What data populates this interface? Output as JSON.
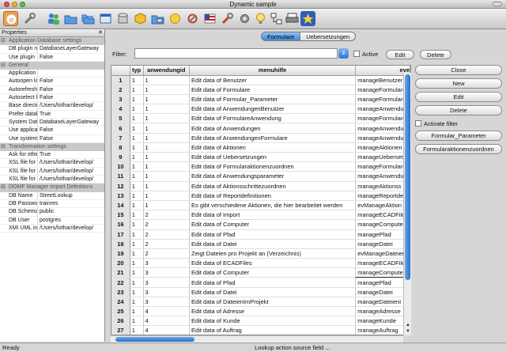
{
  "window": {
    "title": "Dynamic sample"
  },
  "toolbar": {
    "icons": [
      "app-logo-icon",
      "wrench-icon",
      "users-icon",
      "folder-open-icon",
      "folders-icon",
      "window-icon",
      "cylinder-icon",
      "folder-computer-icon",
      "sun-icon",
      "wrench-gear-icon",
      "flag-icon",
      "wrench-tool-icon",
      "gear-icon",
      "lightbulb-icon",
      "flowchart-icon",
      "print-icon",
      "star-icon"
    ]
  },
  "properties": {
    "title": "Properties",
    "groups": [
      {
        "name": "Application Database settings",
        "rows": [
          {
            "key": "DB plugin nam",
            "value": "DatabaseLayerGateway"
          },
          {
            "key": "Use plugin",
            "value": "False"
          }
        ]
      },
      {
        "name": "General",
        "rows": [
          {
            "key": "Application D",
            "value": ""
          },
          {
            "key": "Autoopen last",
            "value": "False"
          },
          {
            "key": "Autorefresh u",
            "value": "False"
          },
          {
            "key": "Autoselect las",
            "value": "False"
          },
          {
            "key": "Base directory",
            "value": "/Users/lothar/develop/"
          },
          {
            "key": "Prefer databas",
            "value": "True"
          },
          {
            "key": "System Databs",
            "value": "DatabaseLayerGateway"
          },
          {
            "key": "Use applicatio",
            "value": "False"
          },
          {
            "key": "Use system Dz",
            "value": "False"
          }
        ]
      },
      {
        "name": "Transformation settings",
        "rows": [
          {
            "key": "Ask for other",
            "value": "True"
          },
          {
            "key": "XSL file for ap",
            "value": "/Users/lothar/develop/"
          },
          {
            "key": "XSL file for se",
            "value": "/Users/lothar/develop/"
          },
          {
            "key": "XSL file for sys",
            "value": "/Users/lothar/develop/"
          }
        ]
      },
      {
        "name": "DOMF Manager import Definitions",
        "rows": [
          {
            "key": "DB Name",
            "value": "StreetLookup"
          },
          {
            "key": "DB Password",
            "value": "trainres"
          },
          {
            "key": "DB Schemanar",
            "value": "public"
          },
          {
            "key": "DB User",
            "value": "postgres"
          },
          {
            "key": "XMI UML input",
            "value": "/Users/lothar/develop/"
          }
        ]
      }
    ]
  },
  "tabs": [
    {
      "label": "Formulare"
    },
    {
      "label": "Uebersetzungen"
    }
  ],
  "filter": {
    "label": "Filter:",
    "value": "",
    "active_label": "Active",
    "edit_label": "Edit",
    "delete_label": "Delete"
  },
  "table": {
    "columns": [
      "",
      "typ",
      "anwendungid",
      "menuhilfe",
      "eve"
    ],
    "rows": [
      [
        "1",
        "1",
        "1",
        "Edit data of Benutzer",
        "manageBenutzer"
      ],
      [
        "2",
        "1",
        "1",
        "Edit data of Formulare",
        "manageFormulare"
      ],
      [
        "3",
        "1",
        "1",
        "Edit data of Formular_Parameter",
        "manageFormulare"
      ],
      [
        "4",
        "1",
        "1",
        "Edit data of AnwendungenBenutzer",
        "manageAnwendu"
      ],
      [
        "5",
        "1",
        "1",
        "Edit data of FormulareAnwendung",
        "manageFormulare"
      ],
      [
        "6",
        "1",
        "1",
        "Edit data of Anwendungen",
        "manageAnwendu"
      ],
      [
        "7",
        "1",
        "1",
        "Edit data of AnwendungenFormulare",
        "manageAnwendu"
      ],
      [
        "8",
        "1",
        "1",
        "Edit data of Aktionen",
        "manageAktionen"
      ],
      [
        "9",
        "1",
        "1",
        "Edit data of Uebersetzungen",
        "manageUeberset"
      ],
      [
        "10",
        "1",
        "1",
        "Edit data of Formularaktionenzuordnen",
        "manageFormulare"
      ],
      [
        "11",
        "1",
        "1",
        "Edit data of Anwendungsparameter",
        "manageAnwendu"
      ],
      [
        "12",
        "1",
        "1",
        "Edit data of Aktionsschrittezuordnen",
        "manageAktionss"
      ],
      [
        "13",
        "1",
        "1",
        "Edit data of Reportdefinitionen",
        "manageReportde"
      ],
      [
        "14",
        "1",
        "1",
        "Es gibt verschiedene Aktionen, die hier bearbeitet werden",
        "evManageAktion"
      ],
      [
        "15",
        "1",
        "2",
        "Edit data of Import",
        "manageECADFile"
      ],
      [
        "16",
        "1",
        "2",
        "Edit data of Computer",
        "manageComputer"
      ],
      [
        "17",
        "1",
        "2",
        "Edit data of Pfad",
        "managePfad"
      ],
      [
        "18",
        "1",
        "2",
        "Edit data of Datei",
        "manageDatei"
      ],
      [
        "19",
        "1",
        "2",
        "Zeigt Dateien pro Projekt an (Verzeichnis)",
        "evManageDateier"
      ],
      [
        "20",
        "1",
        "3",
        "Edit data of ECADFiles",
        "manageECADFile"
      ],
      [
        "21",
        "1",
        "3",
        "Edit data of Computer",
        "manageComputer"
      ],
      [
        "22",
        "1",
        "3",
        "Edit data of Pfad",
        "managePfad"
      ],
      [
        "23",
        "1",
        "3",
        "Edit data of Datei",
        "manageDatei"
      ],
      [
        "24",
        "1",
        "3",
        "Edit data of DateienImProjekt",
        "manageDateienI"
      ],
      [
        "25",
        "1",
        "4",
        "Edit data of Adresse",
        "manageAdresse"
      ],
      [
        "26",
        "1",
        "4",
        "Edit data of Kunde",
        "manageKunde"
      ],
      [
        "27",
        "1",
        "4",
        "Edit data of Auftrag",
        "manageAuftrag"
      ]
    ],
    "selected_row": 20
  },
  "actions": {
    "close": "Close",
    "new": "New",
    "edit": "Edit",
    "delete": "Delete",
    "activate_filter": "Activate filter",
    "formular_parameter": "Formular_Parameter",
    "formularaktionen": "Formularaktionenzuordnen"
  },
  "status": {
    "left": "Ready",
    "middle": "Lookup action source field ..."
  }
}
